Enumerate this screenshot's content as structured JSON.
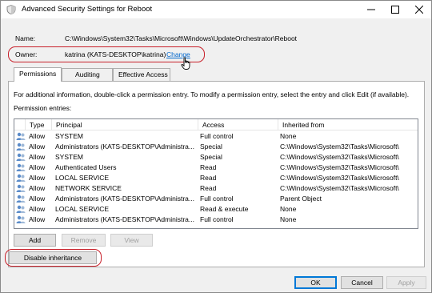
{
  "window": {
    "title": "Advanced Security Settings for Reboot",
    "minimize_glyph": "—",
    "maximize_glyph": "☐",
    "close_glyph": "✕"
  },
  "name_label": "Name:",
  "name_value": "C:\\Windows\\System32\\Tasks\\Microsoft\\Windows\\UpdateOrchestrator\\Reboot",
  "owner_label": "Owner:",
  "owner_value": "katrina (KATS-DESKTOP\\katrina)",
  "owner_change_link": "Change",
  "tabs": [
    {
      "label": "Permissions",
      "active": true
    },
    {
      "label": "Auditing",
      "active": false
    },
    {
      "label": "Effective Access",
      "active": false
    }
  ],
  "info_text": "For additional information, double-click a permission entry. To modify a permission entry, select the entry and click Edit (if available).",
  "entries_label": "Permission entries:",
  "columns": [
    "Type",
    "Principal",
    "Access",
    "Inherited from"
  ],
  "rows": [
    {
      "type": "Allow",
      "principal": "SYSTEM",
      "access": "Full control",
      "inherited": "None"
    },
    {
      "type": "Allow",
      "principal": "Administrators (KATS-DESKTOP\\Administra...",
      "access": "Special",
      "inherited": "C:\\Windows\\System32\\Tasks\\Microsoft\\"
    },
    {
      "type": "Allow",
      "principal": "SYSTEM",
      "access": "Special",
      "inherited": "C:\\Windows\\System32\\Tasks\\Microsoft\\"
    },
    {
      "type": "Allow",
      "principal": "Authenticated Users",
      "access": "Read",
      "inherited": "C:\\Windows\\System32\\Tasks\\Microsoft\\"
    },
    {
      "type": "Allow",
      "principal": "LOCAL SERVICE",
      "access": "Read",
      "inherited": "C:\\Windows\\System32\\Tasks\\Microsoft\\"
    },
    {
      "type": "Allow",
      "principal": "NETWORK SERVICE",
      "access": "Read",
      "inherited": "C:\\Windows\\System32\\Tasks\\Microsoft\\"
    },
    {
      "type": "Allow",
      "principal": "Administrators (KATS-DESKTOP\\Administra...",
      "access": "Full control",
      "inherited": "Parent Object"
    },
    {
      "type": "Allow",
      "principal": "LOCAL SERVICE",
      "access": "Read & execute",
      "inherited": "None"
    },
    {
      "type": "Allow",
      "principal": "Administrators (KATS-DESKTOP\\Administra...",
      "access": "Full control",
      "inherited": "None"
    }
  ],
  "buttons": {
    "add": "Add",
    "remove": "Remove",
    "view": "View",
    "disable_inheritance": "Disable inheritance",
    "ok": "OK",
    "cancel": "Cancel",
    "apply": "Apply"
  },
  "colors": {
    "highlight_outline": "#c8202a",
    "link": "#0066cc",
    "focus": "#0078d7"
  }
}
